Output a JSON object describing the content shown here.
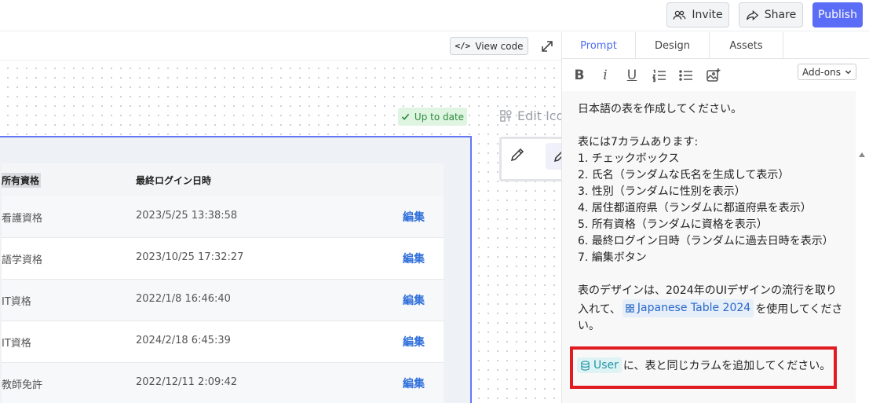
{
  "topbar": {
    "invite_label": "Invite",
    "share_label": "Share",
    "publish_label": "Publish",
    "invite_icon": "users-icon",
    "share_icon": "share-icon"
  },
  "canvas": {
    "view_code_glyph": "</>",
    "view_code_label": "View code",
    "status_label": "Up to date",
    "edit_icons_label": "Edit Icon"
  },
  "table": {
    "headers": {
      "qualification": "所有資格",
      "last_login": "最終ログイン日時"
    },
    "rows": [
      {
        "qualification": "看護資格",
        "last_login": "2023/5/25 13:38:58",
        "action": "編集"
      },
      {
        "qualification": "語学資格",
        "last_login": "2023/10/25 17:32:27",
        "action": "編集"
      },
      {
        "qualification": "IT資格",
        "last_login": "2022/1/8 16:46:40",
        "action": "編集"
      },
      {
        "qualification": "IT資格",
        "last_login": "2024/2/18 6:45:39",
        "action": "編集"
      },
      {
        "qualification": "教師免許",
        "last_login": "2022/12/11 2:09:42",
        "action": "編集"
      }
    ]
  },
  "panel": {
    "tabs": [
      "Prompt",
      "Design",
      "Assets"
    ],
    "active_tab": "Prompt",
    "format": {
      "bold": "B",
      "italic": "i",
      "underline": "U"
    },
    "addons_label": "Add-ons",
    "prompt": {
      "line1": "日本語の表を作成してください。",
      "line2": "表には7カラムあります:",
      "items": [
        "1. チェックボックス",
        "2. 氏名（ランダムな氏名を生成して表示）",
        "3. 性別（ランダムに性別を表示）",
        "4. 居住都道府県（ランダムに都道府県を表示）",
        "5. 所有資格（ランダムに資格を表示）",
        "6. 最終ログイン日時（ランダムに過去日時を表示）",
        "7. 編集ボタン"
      ],
      "design_pre": "表のデザインは、2024年のUIデザインの流行を取り入れて、",
      "design_chip": "Japanese Table 2024",
      "design_post": "を使用してください。",
      "user_chip": "User",
      "user_post": "に、表と同じカラムを追加してください。"
    }
  },
  "colors": {
    "accent": "#5b6cf6",
    "frame_border": "#6677f2",
    "edit_link": "#2f6fdb",
    "highlight": "#e01b22",
    "status_bg": "#dff5e1"
  }
}
